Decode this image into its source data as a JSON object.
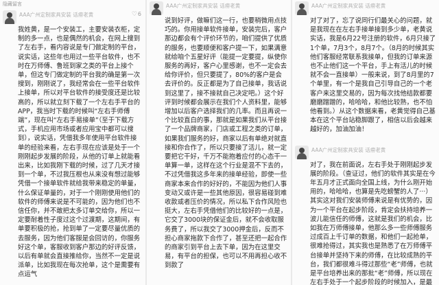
{
  "column1": {
    "topbar": "隐藏留言",
    "posts": [
      {
        "author": "AAA广州定制家具安装 话痨老黄",
        "likes": "6",
        "text": "我姓黄，是一个安装工，主要安装衣柜，定制的多一点，也是偶然的机会，在网上搜到了左右手，看内容说是专门做定制的平台，说实话，这些年也用过一些平台软件，也不时在万师傅、鲁班到家之类的平台上接个单，但这专门做定制的平台我的确是第一次搜到，刚刚说了，我经常会在一些平台软件上接单，所以对平台软件的接受度还是比较高的，所以就立刻下载了一个左右手平台的APP，我当时下载的时候叫“左右手师傅端”，现在叫“左右手易接单”（至于下载方式，手机应用市场或者应用宝中都可以搜到），说实话，凭借我多年使用平台软件接单的经验来看，左右手现在应该是处于一个刚刚起步发展的阶段，从他的订单上就能看出来，比如我刚下载的时候，过了几天才接到一个单，不过我压根也从来没有想过能够凭借一个接单软件就给我带来稳定的单量，什么保证单量的，对于一个刚刚使用他们的软件的师傅来说是不可能的，因为他们也不信任你，并不敢把太多订单交给你，所以一定要耐着性子度过这个过渡期，这期间，有单要积极的抢，抢到单了一定要尽量优质的去服务，因为他们客服是会回访的，你服务好这个单，客服收到客户那边的好评反馈，以后有单就会直接推给你，当然不一定是说派单，比如我现在每次抢单，这个是需要有点运气"
      }
    ]
  },
  "column2": {
    "posts": [
      {
        "author": "AAA广州定制家具安装 话痨老黄",
        "likes": "",
        "text": "说到好评，做嘛们这一行，也要稍微用点技巧的。你用接单软件接单，安装完后，客户那边都会有个评价环节的，咱们提供了优质的服务，也要顺便和客户提一下，如果满意就给咱个五星好评（能提一定要提，纵使你服务的再好，客户心里感谢，也不一定会去给你评价，但只要提了，80%的客户是会去评价的。反正都是为了自己接单，我话说到这里了，接不接就自己决定吧。）这个好评到时候都会展示在我们个人资料里，能够增加以后客户选择我们的几率。而且再说一个比较直白的事，那就是如果我们从平台接了一个品牌商家，门店或工程之类的订单，如果我们服务的好，商家以后有单绝对就直接和你合作了，所以只要接了活儿，就一定要把它干好，千万不能抱着应付的心态干一单算一单，这样在这个行业是混不下去的，不过凭借我这多年来的接单经验，即使一些商家本来合作的好好的，不能因为他们人事变动又或许是一些其他原因，很容易碰到难收款或者压价的情况，所以私下合作风险也挺大，左右手凭借他们的比较好的一点是，它交了3000块的保证金后，就不会收取服务费了，所以我交了3000押金后，反而不担心商家拖款下合作了，甚至还把一起合作的商家引到平台上去下单，因为在这里交易，有平台的担保，也可以不用再担心收不到款了"
      }
    ]
  },
  "column3": {
    "posts": [
      {
        "author": "AAA广州定制家具安装 话痨老黄",
        "likes": "",
        "text": "对了对了，忘了说同行们最关心的问题，就是我现在在左右手接单接到多少单，老黄说实话，我是6月22号注册的软件，6月只接了1个单，7月3个，8月7个。（8月的时候其实他们客服经常联系我接单，但我的订单来源也不止他们这一个平台，手上有活儿的时候就不会一直接单）一般来说，到了8月里的7个单里，有一个是我自己引导自己的一个老客户来这里交易的，因为每次找他结款都要磨磨蹭蹭的，哈哈哈，和他比较熟，也不怕他看到。）从这个数据来看，老黄觉得自己基本在这个平台站稳脚跟了，相信以后会越来越好的，加油加油！"
      },
      {
        "author": "AAA广州定制家具安装 话痨老黄",
        "likes": "",
        "text": "对了，我在前面说，左右手处于刚刚起步发展的阶段。（查证过，他们的软件其实是在今年五月才正式面向全国上线，为什么刚开始用的，哈哈哈，也算是先吃螃蟹的人了···）其实这对我们安装师傅来说是有优势的，因为一个平台在起步阶段，肯定会扶持培养一波儿能信任的师傅，这就是我们的机会，比如我在万师傅接单，他那么多一些师傅服务过成百上千订单的数据，和他们一起抢单，很难抢得过，其实我也是熟悉了在万师傅平台接单并坚持下来的师傅，在比较成熟的平台，我们都很难斗得过那些“老”师傅，也就是平台培养出来的那批“老”师傅，所以现在左右手处于一个起步阶段的时候加入，是最佳的选择"
      }
    ]
  }
}
